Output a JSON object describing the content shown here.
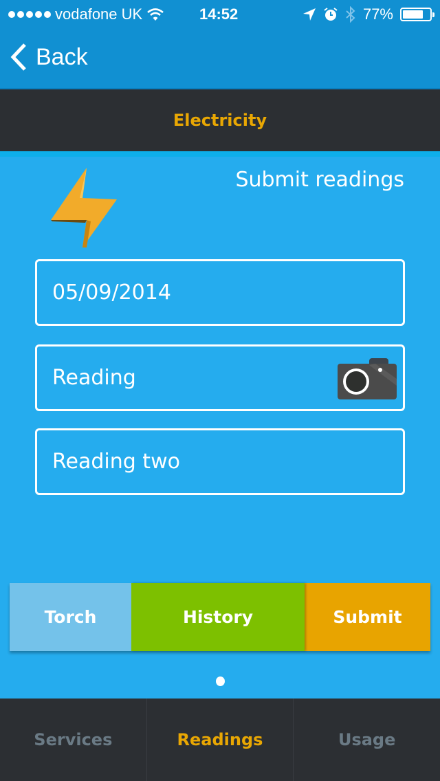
{
  "status_bar": {
    "signal_dots": 5,
    "carrier": "vodafone UK",
    "time": "14:52",
    "battery_percent": "77%",
    "battery_level": 0.77,
    "icons": [
      "wifi-icon",
      "location-arrow-icon",
      "alarm-icon",
      "bluetooth-icon",
      "battery-icon"
    ]
  },
  "nav": {
    "back_label": "Back"
  },
  "section": {
    "title": "Electricity"
  },
  "form": {
    "heading": "Submit readings",
    "date_value": "05/09/2014",
    "reading_placeholder": "Reading",
    "reading_two_placeholder": "Reading two"
  },
  "actions": {
    "torch": "Torch",
    "history": "History",
    "submit": "Submit"
  },
  "pager": {
    "pages": 1,
    "current": 1
  },
  "tabs": [
    {
      "label": "Services",
      "active": false
    },
    {
      "label": "Readings",
      "active": true
    },
    {
      "label": "Usage",
      "active": false
    }
  ],
  "colors": {
    "nav_blue": "#1190d2",
    "content_blue": "#25acee",
    "dark": "#2c2f33",
    "accent_orange": "#e9a703",
    "torch": "#74c2ea",
    "history": "#7dc000",
    "submit": "#e8a400"
  }
}
